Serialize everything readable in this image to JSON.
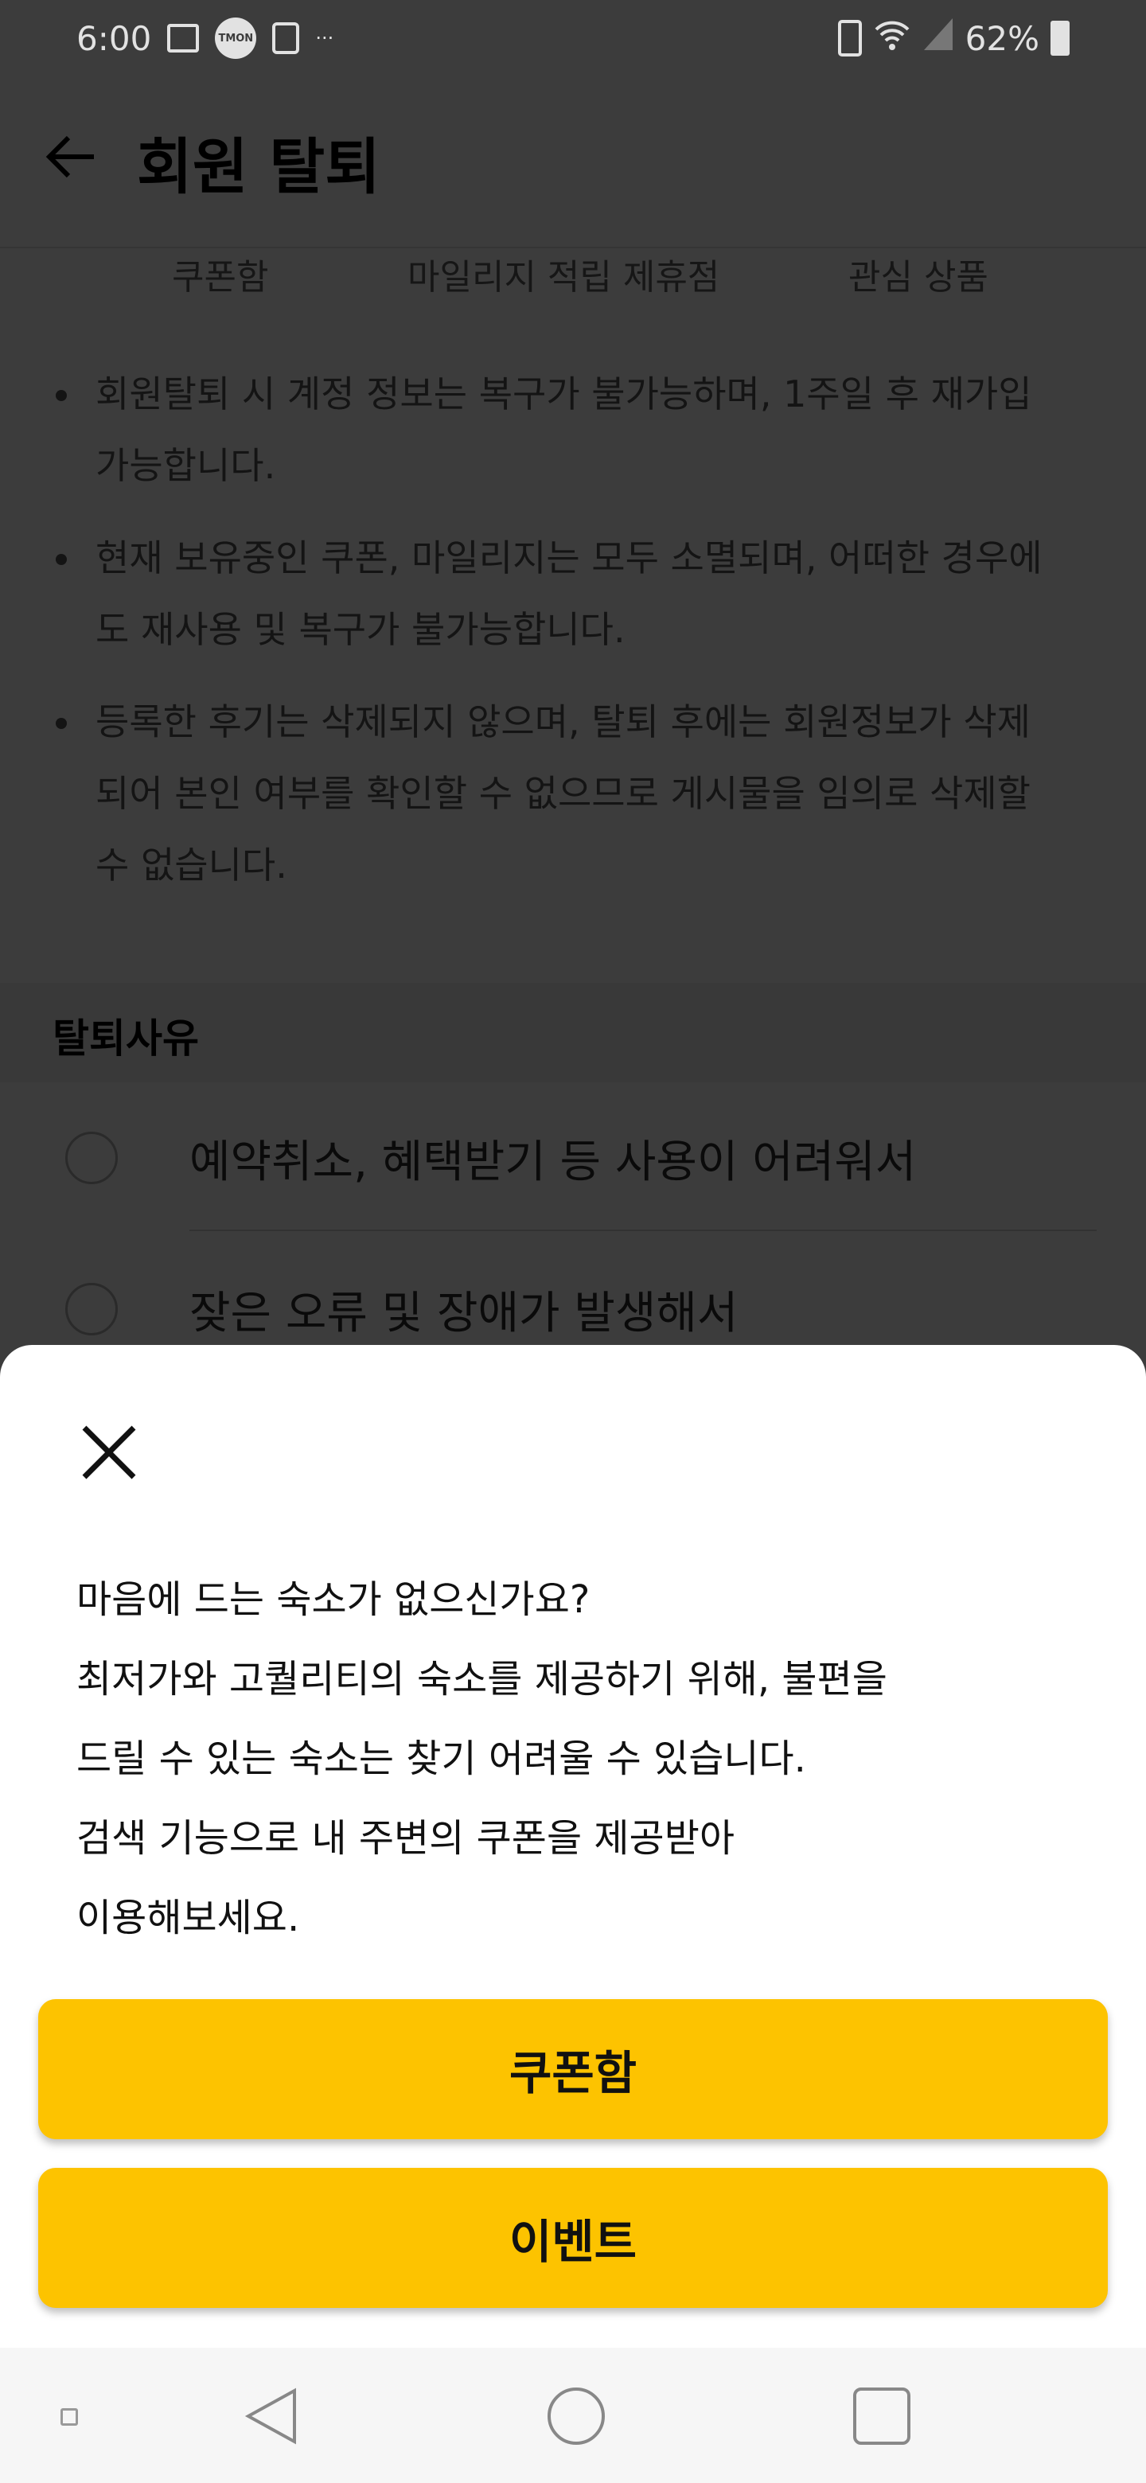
{
  "status_bar": {
    "time": "6:00",
    "notification_app": "TMON",
    "battery": "62%"
  },
  "header": {
    "title": "회원 탈퇴",
    "back_icon": "arrow-left-icon"
  },
  "tabs": [
    "쿠폰함",
    "마일리지 적립 제휴점",
    "관심 상품"
  ],
  "notices": [
    "회원탈퇴 시 계정 정보는 복구가 불가능하며, 1주일 후 재가입 가능합니다.",
    "현재 보유중인 쿠폰, 마일리지는 모두 소멸되며, 어떠한 경우에도 재사용 및 복구가 불가능합니다.",
    "등록한 후기는 삭제되지 않으며, 탈퇴 후에는 회원정보가 삭제되어 본인 여부를 확인할 수 없으므로 게시물을 임의로 삭제할 수 없습니다."
  ],
  "reasons": {
    "title": "탈퇴사유",
    "options": [
      "예약취소, 혜택받기 등 사용이 어려워서",
      "잦은 오류 및 장애가 발생해서"
    ]
  },
  "sheet": {
    "lines": [
      "마음에 드는 숙소가 없으신가요?",
      "최저가와 고퀄리티의 숙소를 제공하기 위해, 불편을",
      "드릴 수 있는 숙소는 찾기 어려울 수 있습니다.",
      "검색 기능으로 내 주변의 쿠폰을 제공받아",
      "이용해보세요."
    ],
    "buttons": [
      "쿠폰함",
      "이벤트"
    ]
  },
  "colors": {
    "accent": "#fdc300"
  }
}
